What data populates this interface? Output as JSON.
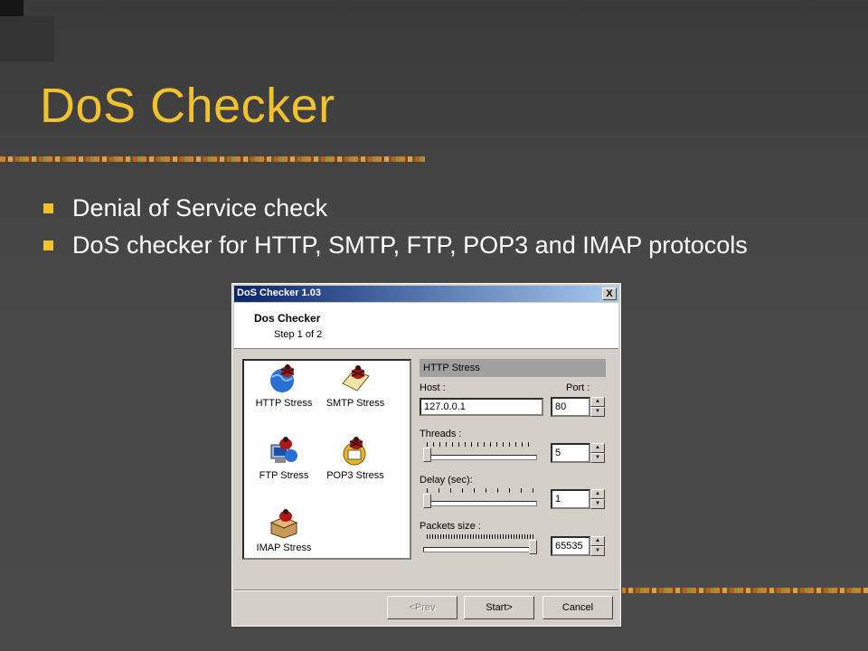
{
  "slide": {
    "title": "DoS Checker",
    "bullets": [
      "Denial of Service check",
      "DoS checker for HTTP, SMTP, FTP, POP3 and IMAP protocols"
    ],
    "colors": {
      "title": "#f2c12e",
      "bullet": "#f2c12e",
      "text": "#ffffff",
      "background": "#474747"
    }
  },
  "dialog": {
    "title": "DoS Checker 1.03",
    "close_label": "X",
    "header": {
      "title": "Dos Checker",
      "step": "Step 1 of 2"
    },
    "tools": [
      {
        "label": "HTTP Stress",
        "icon": "http-globe-icon"
      },
      {
        "label": "SMTP Stress",
        "icon": "smtp-mail-icon"
      },
      {
        "label": "FTP Stress",
        "icon": "ftp-computer-icon"
      },
      {
        "label": "POP3 Stress",
        "icon": "pop3-mailbox-icon"
      },
      {
        "label": "IMAP Stress",
        "icon": "imap-box-icon"
      }
    ],
    "group": {
      "title": "HTTP Stress",
      "host_label": "Host :",
      "port_label": "Port :",
      "host_value": "127.0.0.1",
      "port_value": "80",
      "threads_label": "Threads :",
      "threads_value": "5",
      "delay_label": "Delay (sec):",
      "delay_value": "1",
      "packets_label": "Packets size :",
      "packets_value": "65535"
    },
    "buttons": {
      "prev": "<Prev",
      "start": "Start>",
      "cancel": "Cancel"
    }
  }
}
